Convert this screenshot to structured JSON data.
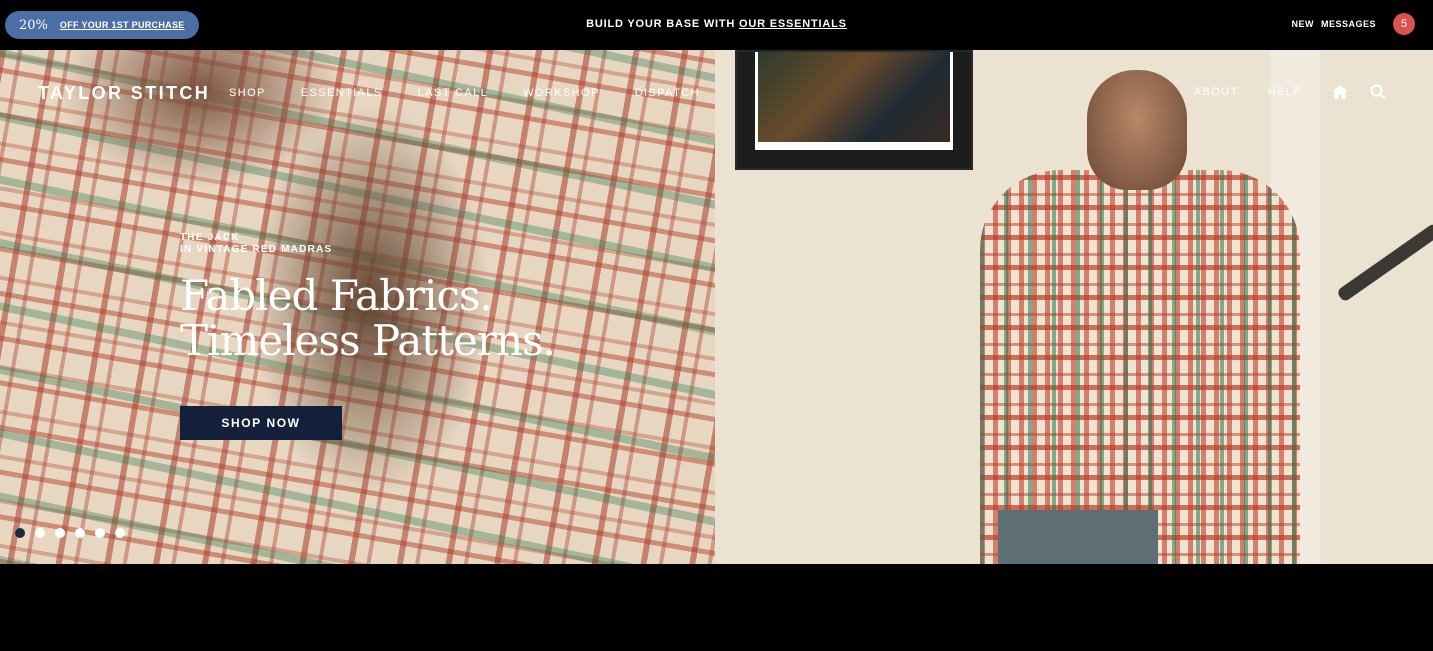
{
  "promo": {
    "percent": "20%",
    "text": "OFF YOUR 1ST PURCHASE",
    "color": "#4a6fa5"
  },
  "announcement": {
    "prefix": "BUILD YOUR BASE WITH",
    "link": "OUR ESSENTIALS"
  },
  "messages": {
    "new_label": "NEW",
    "messages_label": "MESSAGES",
    "count": "5",
    "badge_color": "#d9534f"
  },
  "nav": {
    "logo": "TAYLOR STITCH",
    "links": [
      "SHOP",
      "ESSENTIALS",
      "LAST CALL",
      "WORKSHOP",
      "DISPATCH"
    ],
    "right_links": [
      "ABOUT",
      "HELP"
    ],
    "icons": [
      "home-icon",
      "search-icon"
    ]
  },
  "hero": {
    "eyebrow_line1": "THE JACK",
    "eyebrow_line2": "IN VINTAGE RED MADRAS",
    "headline_line1": "Fabled Fabrics.",
    "headline_line2": "Timeless Patterns.",
    "cta": "SHOP NOW",
    "cta_color": "#14203a",
    "slide_count": 6,
    "active_slide": 1
  }
}
